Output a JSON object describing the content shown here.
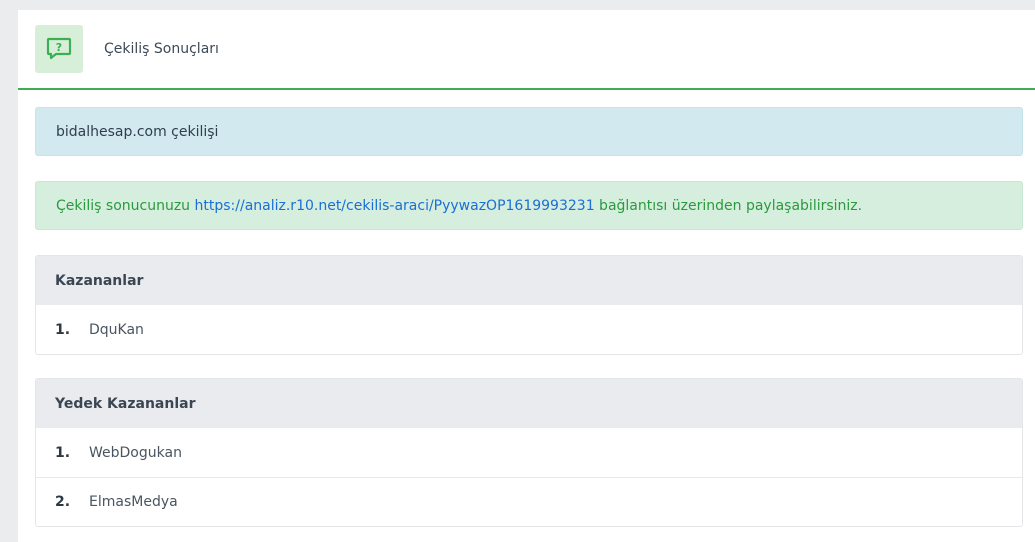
{
  "header": {
    "title": "Çekiliş Sonuçları",
    "icon": "question-chat-icon",
    "icon_glyph": "?"
  },
  "alerts": {
    "info_text": "bidalhesap.com çekilişi",
    "success_prefix": "Çekiliş sonucunuzu ",
    "success_link": "https://analiz.r10.net/cekilis-araci/PyywazOP1619993231",
    "success_suffix": " bağlantısı üzerinden paylaşabilirsiniz."
  },
  "winners": {
    "title": "Kazananlar",
    "items": [
      {
        "num": "1.",
        "name": "DquKan"
      }
    ]
  },
  "backups": {
    "title": "Yedek Kazananlar",
    "items": [
      {
        "num": "1.",
        "name": "WebDogukan"
      },
      {
        "num": "2.",
        "name": "ElmasMedya"
      }
    ]
  },
  "colors": {
    "accent": "#3cae53",
    "link": "#1a6fd6",
    "info_bg": "#d2e9ef",
    "success_bg": "#d6eedd"
  }
}
